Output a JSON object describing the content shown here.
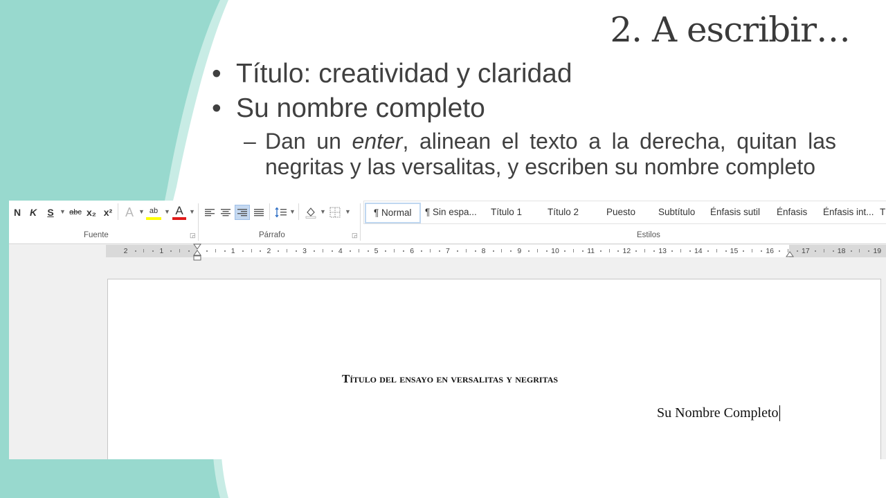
{
  "slide": {
    "title": "2. A escribir…",
    "bullets": [
      {
        "text": "Título: creatividad y claridad"
      },
      {
        "text": "Su nombre completo"
      }
    ],
    "sub_bullet": {
      "before": "Dan un ",
      "italic": "enter",
      "after": ", alinean el texto a la derecha, quitan las negritas y las versalitas, y escriben su nombre completo"
    },
    "colors": {
      "teal": "#98d9ce",
      "teal_light": "#c8ece5",
      "text": "#404040"
    }
  },
  "word": {
    "font_group": {
      "label": "Fuente",
      "buttons": {
        "bold": "N",
        "italic": "K",
        "underline": "S",
        "strikethrough": "abc",
        "subscript": "x₂",
        "superscript": "x²",
        "text_effects": "A",
        "highlight": "ab",
        "font_color": "A"
      }
    },
    "paragraph_group": {
      "label": "Párrafo",
      "active_alignment": "align-right"
    },
    "styles_group": {
      "label": "Estilos",
      "items": [
        "¶ Normal",
        "¶ Sin espa...",
        "Título 1",
        "Título 2",
        "Puesto",
        "Subtítulo",
        "Énfasis sutil",
        "Énfasis",
        "Énfasis int...",
        "T"
      ],
      "selected": "¶ Normal"
    },
    "ruler": {
      "numbers": [
        "2",
        "1",
        "1",
        "2",
        "3",
        "4",
        "5",
        "6",
        "7",
        "8",
        "9",
        "10",
        "11",
        "12",
        "13",
        "14",
        "15",
        "16",
        "17",
        "18",
        "19"
      ]
    },
    "document": {
      "title": "Título del ensayo en versalitas y negritas",
      "author": "Su Nombre Completo"
    }
  }
}
